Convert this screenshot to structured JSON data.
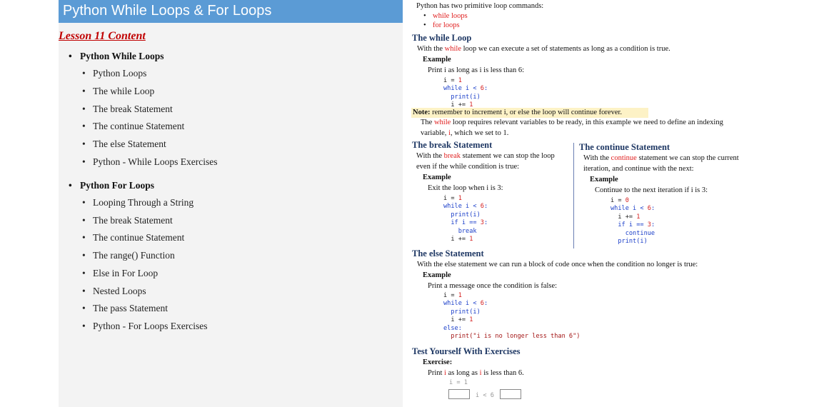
{
  "left": {
    "title": "Python While Loops & For Loops",
    "lesson_heading": "Lesson 11 Content",
    "sections": [
      {
        "title": "Python While Loops",
        "items": [
          "Python Loops",
          "The while Loop",
          "The break Statement",
          "The continue Statement",
          "The else Statement",
          "Python - While Loops Exercises"
        ]
      },
      {
        "title": "Python For Loops",
        "items": [
          "Looping Through a String",
          "The break Statement",
          "The continue Statement",
          "The range() Function",
          "Else in For Loop",
          "Nested Loops",
          "The pass Statement",
          "Python - For Loops Exercises"
        ]
      }
    ]
  },
  "doc": {
    "intro": "Python has two primitive loop commands:",
    "loop_types": [
      "while loops",
      "for loops"
    ],
    "while_loop": {
      "heading": "The while Loop",
      "text_pre": "With the ",
      "keyword": "while",
      "text_post": " loop we can execute a set of statements as long as a condition is true.",
      "example_label": "Example",
      "example_desc": "Print i as long as i is less than 6:",
      "code": [
        "i = 1",
        "while i < 6:",
        "  print(i)",
        "  i += 1"
      ],
      "note_label": "Note:",
      "note_text": " remember to increment i, or else the loop will continue forever.",
      "req_line1_pre": "The ",
      "req_line1_kw": "while",
      "req_line1_post": " loop requires relevant variables to be ready, in this example we need to define an indexing",
      "req_line2_pre": "variable, ",
      "req_line2_kw": "i",
      "req_line2_post": ", which we set to 1."
    },
    "break_statement": {
      "heading": "The break Statement",
      "line1_pre": "With the ",
      "line1_kw": "break",
      "line1_post": " statement we can stop the loop",
      "line2": "even if the while condition is true:",
      "example_label": "Example",
      "example_desc": "Exit the loop when i is 3:",
      "code": [
        "i = 1",
        "while i < 6:",
        "  print(i)",
        "  if i == 3:",
        "    break",
        "  i += 1"
      ]
    },
    "continue_statement": {
      "heading": "The continue Statement",
      "line1_pre": "With the ",
      "line1_kw": "continue",
      "line1_post": " statement we can stop the current",
      "line2": "iteration, and continue with the next:",
      "example_label": "Example",
      "example_desc": "Continue to the next iteration if i is 3:",
      "code": [
        "i = 0",
        "while i < 6:",
        "  i += 1",
        "  if i == 3:",
        "    continue",
        "  print(i)"
      ]
    },
    "else_statement": {
      "heading": "The else Statement",
      "text": "With the else statement we can run a block of code once when the condition no longer is true:",
      "example_label": "Example",
      "example_desc": "Print a message once the condition is false:",
      "code": [
        "i = 1",
        "while i < 6:",
        "  print(i)",
        "  i += 1",
        "else:",
        "  print(\"i is no longer less than 6\")"
      ]
    },
    "exercises": {
      "heading": "Test Yourself With Exercises",
      "label": "Exercise:",
      "desc_pre": "Print ",
      "desc_kw1": "i",
      "desc_mid": " as long as ",
      "desc_kw2": "i",
      "desc_post": " is less than 6.",
      "code_line1": "i = 1",
      "code_line2": "i < 6"
    }
  }
}
